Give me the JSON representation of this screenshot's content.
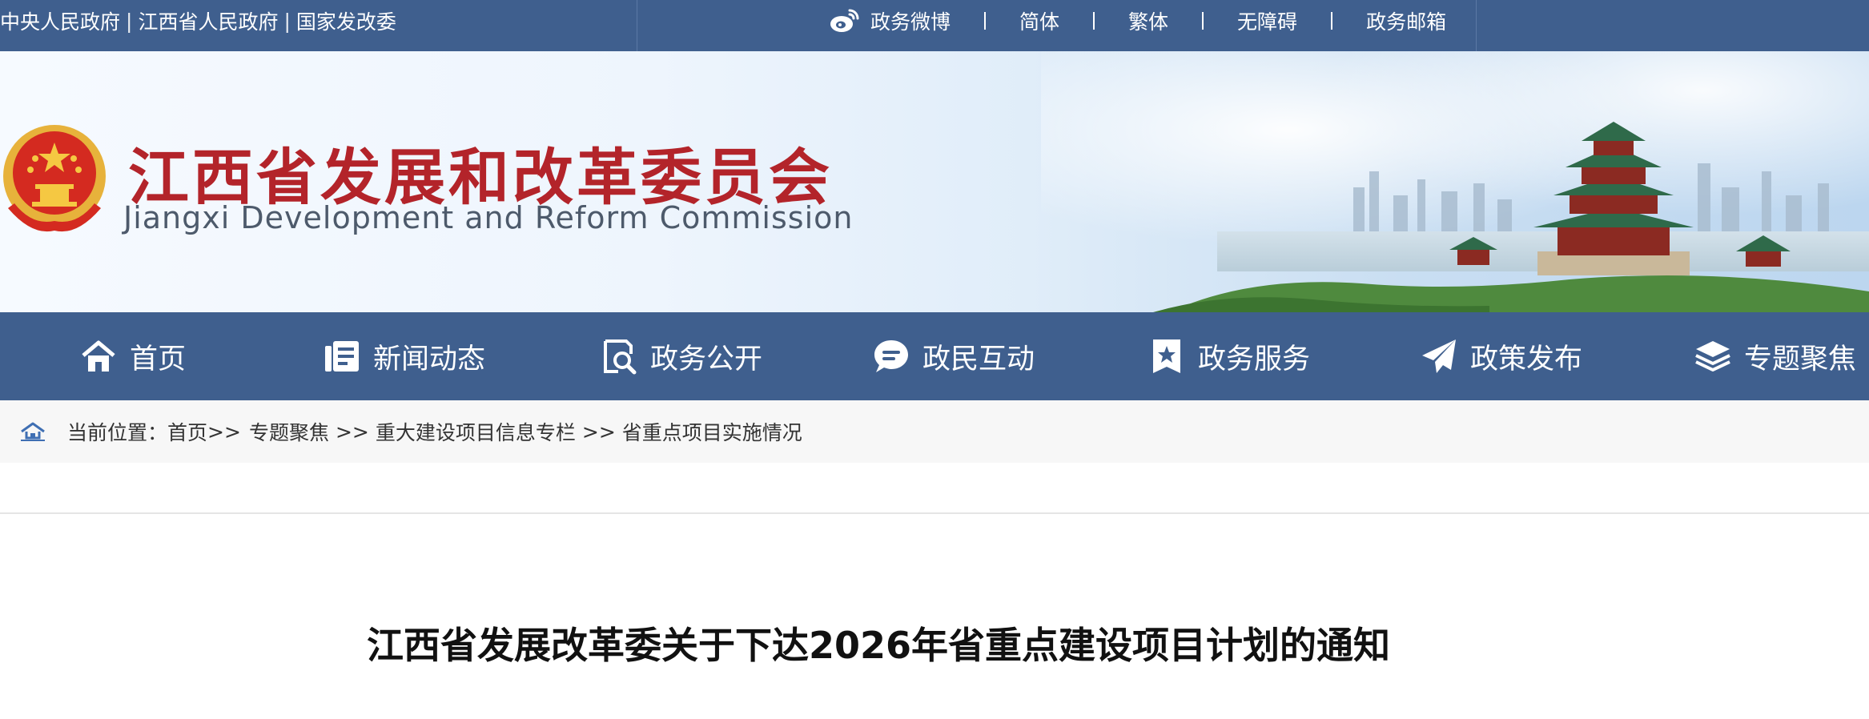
{
  "top_bar": {
    "links": [
      "中央人民政府",
      "江西省人民政府",
      "国家发改委"
    ],
    "separator": "|",
    "right_items": [
      "政务微博",
      "简体",
      "繁体",
      "无障碍",
      "政务邮箱"
    ]
  },
  "banner": {
    "title_cn": "江西省发展和改革委员会",
    "title_en": "Jiangxi Development and Reform Commission"
  },
  "nav": {
    "items": [
      {
        "label": "首页",
        "icon": "home-icon"
      },
      {
        "label": "新闻动态",
        "icon": "news-icon"
      },
      {
        "label": "政务公开",
        "icon": "search-document-icon"
      },
      {
        "label": "政民互动",
        "icon": "chat-bubble-icon"
      },
      {
        "label": "政务服务",
        "icon": "star-bookmark-icon"
      },
      {
        "label": "政策发布",
        "icon": "paper-plane-icon"
      },
      {
        "label": "专题聚焦",
        "icon": "layers-icon"
      }
    ]
  },
  "breadcrumb": {
    "prefix": "当前位置：",
    "items": [
      "首页",
      "专题聚焦",
      "重大建设项目信息专栏",
      "省重点项目实施情况"
    ],
    "separator": ">>"
  },
  "article": {
    "title": "江西省发展改革委关于下达2026年省重点建设项目计划的通知"
  },
  "colors": {
    "nav_blue": "#3f5f8e",
    "title_red": "#b3242a",
    "breadcrumb_bg": "#f7f7f7"
  }
}
